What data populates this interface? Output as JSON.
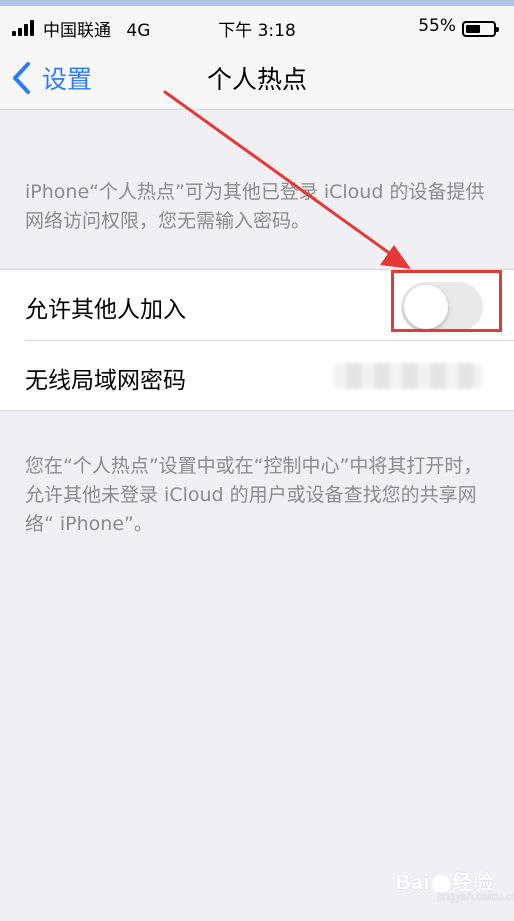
{
  "status_bar": {
    "carrier": "中国联通",
    "network": "4G",
    "time": "下午 3:18",
    "battery_percent": "55%",
    "battery_level": 0.55
  },
  "nav": {
    "back_label": "设置",
    "title": "个人热点"
  },
  "description_top": "iPhone“个人热点”可为其他已登录 iCloud 的设备提供网络访问权限，您无需输入密码。",
  "settings": {
    "allow_others_label": "允许其他人加入",
    "allow_others_enabled": false,
    "wifi_password_label": "无线局域网密码"
  },
  "description_bottom": "您在“个人热点”设置中或在“控制中心”中将其打开时，允许其他未登录 iCloud 的用户或设备查找您的共享网络“ iPhone”。",
  "watermark": {
    "brand": "Bai",
    "suffix": "经验",
    "url": "jingyan.baidu.com"
  },
  "colors": {
    "accent": "#2d7cf6",
    "annotation": "#e53935",
    "background": "#efeff4"
  }
}
